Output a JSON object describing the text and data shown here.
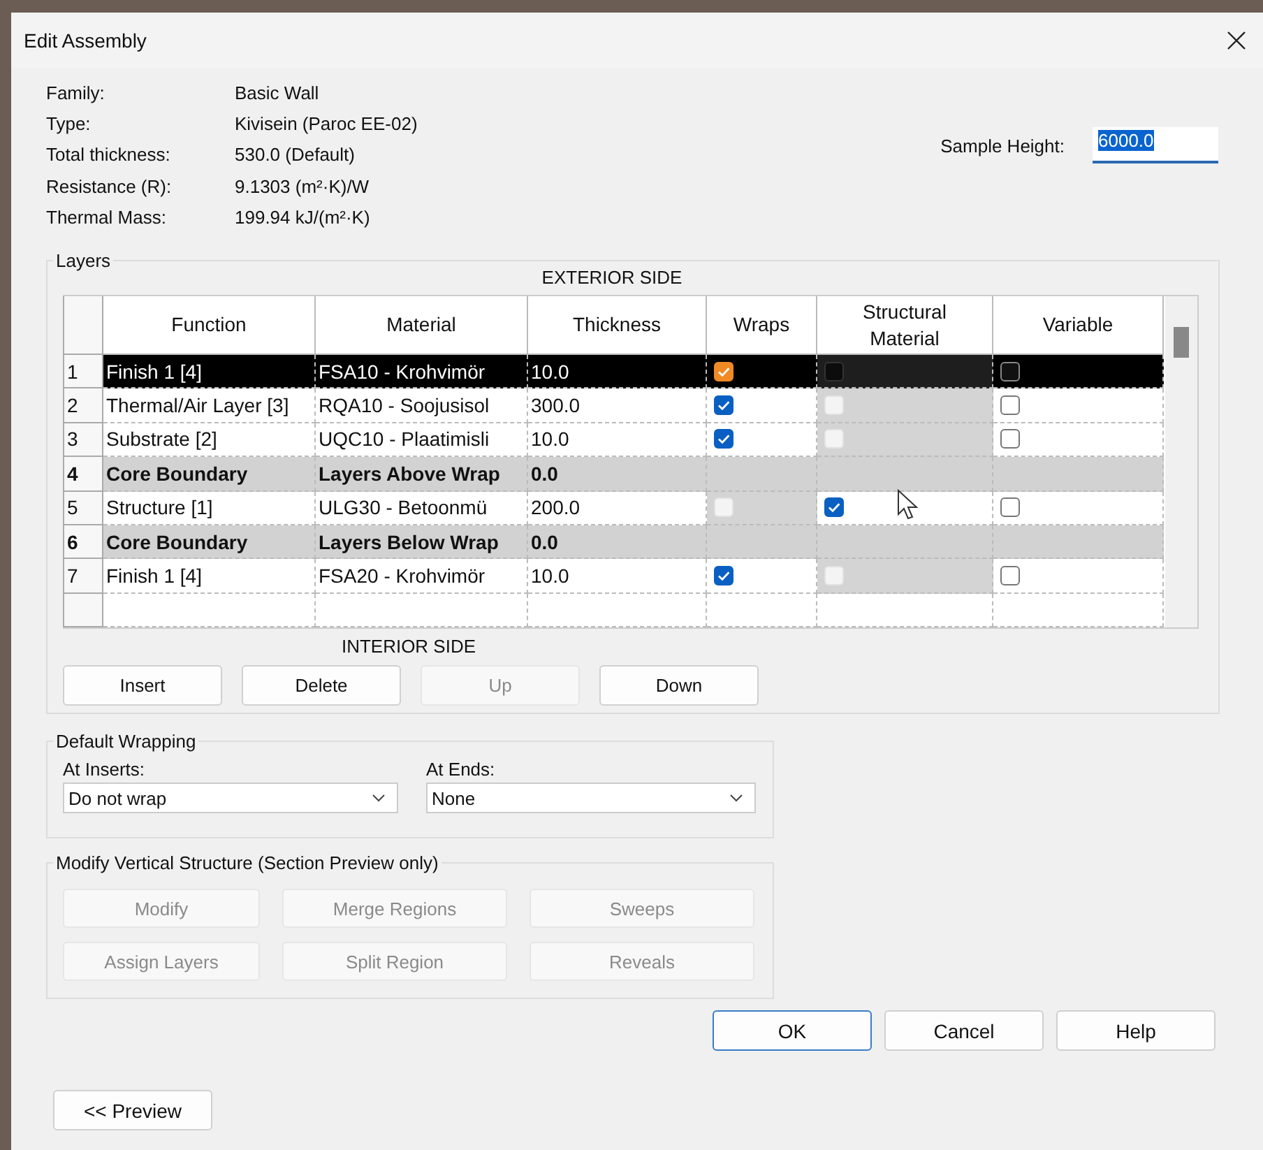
{
  "window": {
    "title": "Edit Assembly"
  },
  "info": [
    {
      "label": "Family:",
      "value": "Basic Wall"
    },
    {
      "label": "Type:",
      "value": "Kivisein (Paroc EE-02)"
    },
    {
      "label": "Total thickness:",
      "value": "530.0 (Default)"
    },
    {
      "label": "Resistance (R):",
      "value": "9.1303 (m²·K)/W"
    },
    {
      "label": "Thermal Mass:",
      "value": "199.94 kJ/(m²·K)"
    }
  ],
  "sample_height": {
    "label": "Sample Height:",
    "value": "6000.0"
  },
  "layers": {
    "title": "Layers",
    "top_caption": "EXTERIOR SIDE",
    "bottom_caption": "INTERIOR SIDE",
    "columns": [
      "Function",
      "Material",
      "Thickness",
      "Wraps",
      "Structural Material",
      "Variable"
    ],
    "rows": [
      {
        "number": "1",
        "kind": "layer",
        "selected": true,
        "function": "Finish 1 [4]",
        "material": "FSA10 - Krohvimör",
        "thickness": "10.0",
        "wraps": {
          "checked": true,
          "disabled": false
        },
        "structural": {
          "checked": false,
          "disabled": true
        },
        "variable": {
          "checked": false
        }
      },
      {
        "number": "2",
        "kind": "layer",
        "selected": false,
        "function": "Thermal/Air Layer [3]",
        "material": "RQA10 - Soojusisol",
        "thickness": "300.0",
        "wraps": {
          "checked": true,
          "disabled": false
        },
        "structural": {
          "checked": false,
          "disabled": true
        },
        "variable": {
          "checked": false
        }
      },
      {
        "number": "3",
        "kind": "layer",
        "selected": false,
        "function": "Substrate [2]",
        "material": "UQC10 - Plaatimisli",
        "thickness": "10.0",
        "wraps": {
          "checked": true,
          "disabled": false
        },
        "structural": {
          "checked": false,
          "disabled": true
        },
        "variable": {
          "checked": false
        }
      },
      {
        "number": "4",
        "kind": "boundary",
        "selected": false,
        "function": "Core Boundary",
        "material": "Layers Above Wrap",
        "thickness": "0.0"
      },
      {
        "number": "5",
        "kind": "layer",
        "selected": false,
        "function": "Structure [1]",
        "material": "ULG30 - Betoonmü",
        "thickness": "200.0",
        "wraps": {
          "checked": false,
          "disabled": true
        },
        "structural": {
          "checked": true,
          "disabled": false
        },
        "variable": {
          "checked": false
        }
      },
      {
        "number": "6",
        "kind": "boundary",
        "selected": false,
        "function": "Core Boundary",
        "material": "Layers Below Wrap",
        "thickness": "0.0"
      },
      {
        "number": "7",
        "kind": "layer",
        "selected": false,
        "function": "Finish 1 [4]",
        "material": "FSA20 - Krohvimör",
        "thickness": "10.0",
        "wraps": {
          "checked": true,
          "disabled": false
        },
        "structural": {
          "checked": false,
          "disabled": true
        },
        "variable": {
          "checked": false
        }
      }
    ],
    "buttons": [
      {
        "label": "Insert",
        "disabled": false
      },
      {
        "label": "Delete",
        "disabled": false
      },
      {
        "label": "Up",
        "disabled": true
      },
      {
        "label": "Down",
        "disabled": false
      }
    ]
  },
  "default_wrapping": {
    "title": "Default Wrapping",
    "at_inserts": {
      "label": "At Inserts:",
      "value": "Do not wrap"
    },
    "at_ends": {
      "label": "At  Ends:",
      "value": "None"
    }
  },
  "modify_vertical": {
    "title": "Modify Vertical Structure (Section Preview only)",
    "buttons": [
      {
        "label": "Modify",
        "disabled": true
      },
      {
        "label": "Merge Regions",
        "disabled": true
      },
      {
        "label": "Sweeps",
        "disabled": true
      },
      {
        "label": "Assign Layers",
        "disabled": true
      },
      {
        "label": "Split Region",
        "disabled": true
      },
      {
        "label": "Reveals",
        "disabled": true
      }
    ]
  },
  "dialog_buttons": [
    {
      "label": "OK",
      "default": true
    },
    {
      "label": "Cancel",
      "default": false
    },
    {
      "label": "Help",
      "default": false
    }
  ],
  "preview_button": "<< Preview"
}
